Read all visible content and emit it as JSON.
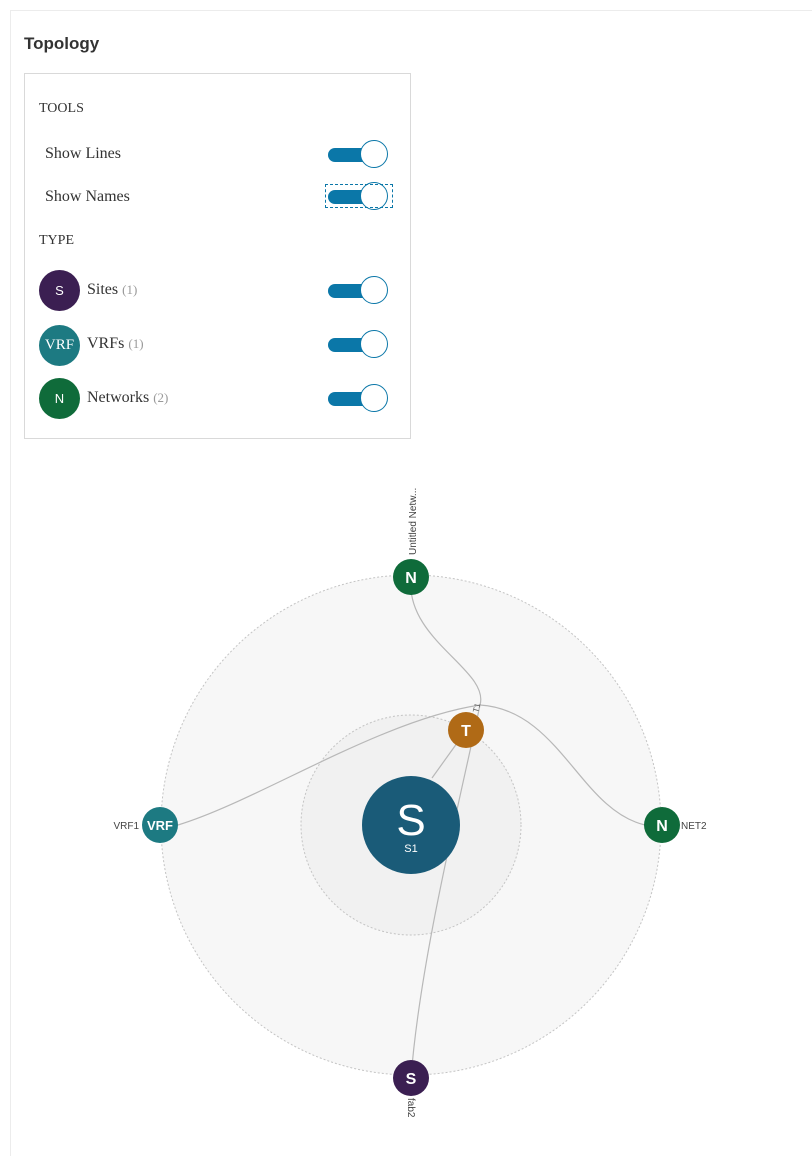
{
  "page": {
    "title": "Topology"
  },
  "tools": {
    "section_label": "TOOLS",
    "show_lines": {
      "label": "Show Lines",
      "on": true
    },
    "show_names": {
      "label": "Show Names",
      "on": true
    }
  },
  "types": {
    "section_label": "TYPE",
    "items": [
      {
        "letter": "S",
        "label": "Sites",
        "count": "(1)",
        "color": "#3b1f52",
        "on": true
      },
      {
        "letter": "VRF",
        "label": "VRFs",
        "count": "(1)",
        "color": "#1d7a82",
        "on": true
      },
      {
        "letter": "N",
        "label": "Networks",
        "count": "(2)",
        "color": "#0f6b3a",
        "on": true
      }
    ]
  },
  "graph": {
    "center": {
      "letter": "S",
      "name": "S1",
      "color": "#1a5b78"
    },
    "nodes": [
      {
        "id": "net-top",
        "letter": "N",
        "name": "Untitled Netw...",
        "color": "#0f6b3a"
      },
      {
        "id": "net2",
        "letter": "N",
        "name": "NET2",
        "color": "#0f6b3a"
      },
      {
        "id": "vrf1",
        "letter": "VRF",
        "name": "VRF1",
        "color": "#1d7a82"
      },
      {
        "id": "fab2",
        "letter": "S",
        "name": "fab2",
        "color": "#3b1f52"
      },
      {
        "id": "t1",
        "letter": "T",
        "name": "T1",
        "color": "#b06a16"
      }
    ]
  }
}
